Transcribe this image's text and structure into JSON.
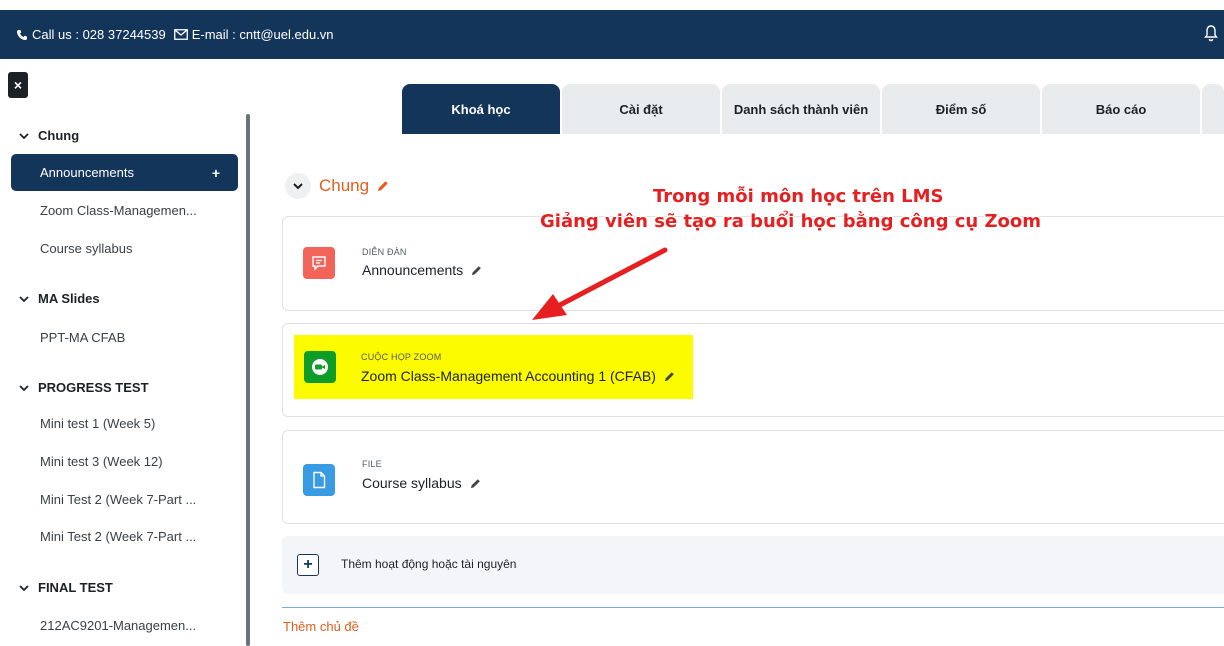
{
  "topbar": {
    "phone": "Call us : 028 37244539",
    "email": "E-mail : cntt@uel.edu.vn",
    "bg": "#14355a"
  },
  "sidebar": {
    "close_label": "×",
    "sections": [
      {
        "title": "Chung",
        "items": [
          "Announcements",
          "Zoom Class-Managemen...",
          "Course syllabus"
        ]
      },
      {
        "title": "MA Slides",
        "items": [
          "PPT-MA CFAB"
        ]
      },
      {
        "title": "PROGRESS TEST",
        "items": [
          "Mini test 1 (Week 5)",
          "Mini test 3 (Week 12)",
          "Mini Test 2 (Week 7-Part ...",
          "Mini Test 2 (Week 7-Part ..."
        ]
      },
      {
        "title": "FINAL TEST",
        "items": [
          "212AC9201-Managemen..."
        ]
      }
    ],
    "active_item": "Announcements",
    "add_symbol": "+"
  },
  "tabs": [
    "Khoá học",
    "Cài đặt",
    "Danh sách thành viên",
    "Điểm số",
    "Báo cáo"
  ],
  "section": {
    "title": "Chung"
  },
  "activities": [
    {
      "type": "DIỄN ĐÀN",
      "name": "Announcements",
      "icon": "forum-icon",
      "color": "#f2645a"
    },
    {
      "type": "CUỘC HỌP ZOOM",
      "name": "Zoom Class-Management Accounting 1 (CFAB)",
      "icon": "zoom-camera-icon",
      "color": "#0f9d27"
    },
    {
      "type": "FILE",
      "name": "Course syllabus",
      "icon": "file-icon",
      "color": "#399be2"
    }
  ],
  "add_activity": {
    "symbol": "+",
    "label": "Thêm hoạt động hoặc tài nguyên"
  },
  "add_topic": "Thêm chủ đề",
  "annotation": {
    "line1": "Trong mỗi môn học trên LMS",
    "line2": "Giảng viên sẽ tạo ra buổi học bằng công cụ Zoom",
    "color": "#e62020",
    "highlight_color": "#fdfb00"
  }
}
